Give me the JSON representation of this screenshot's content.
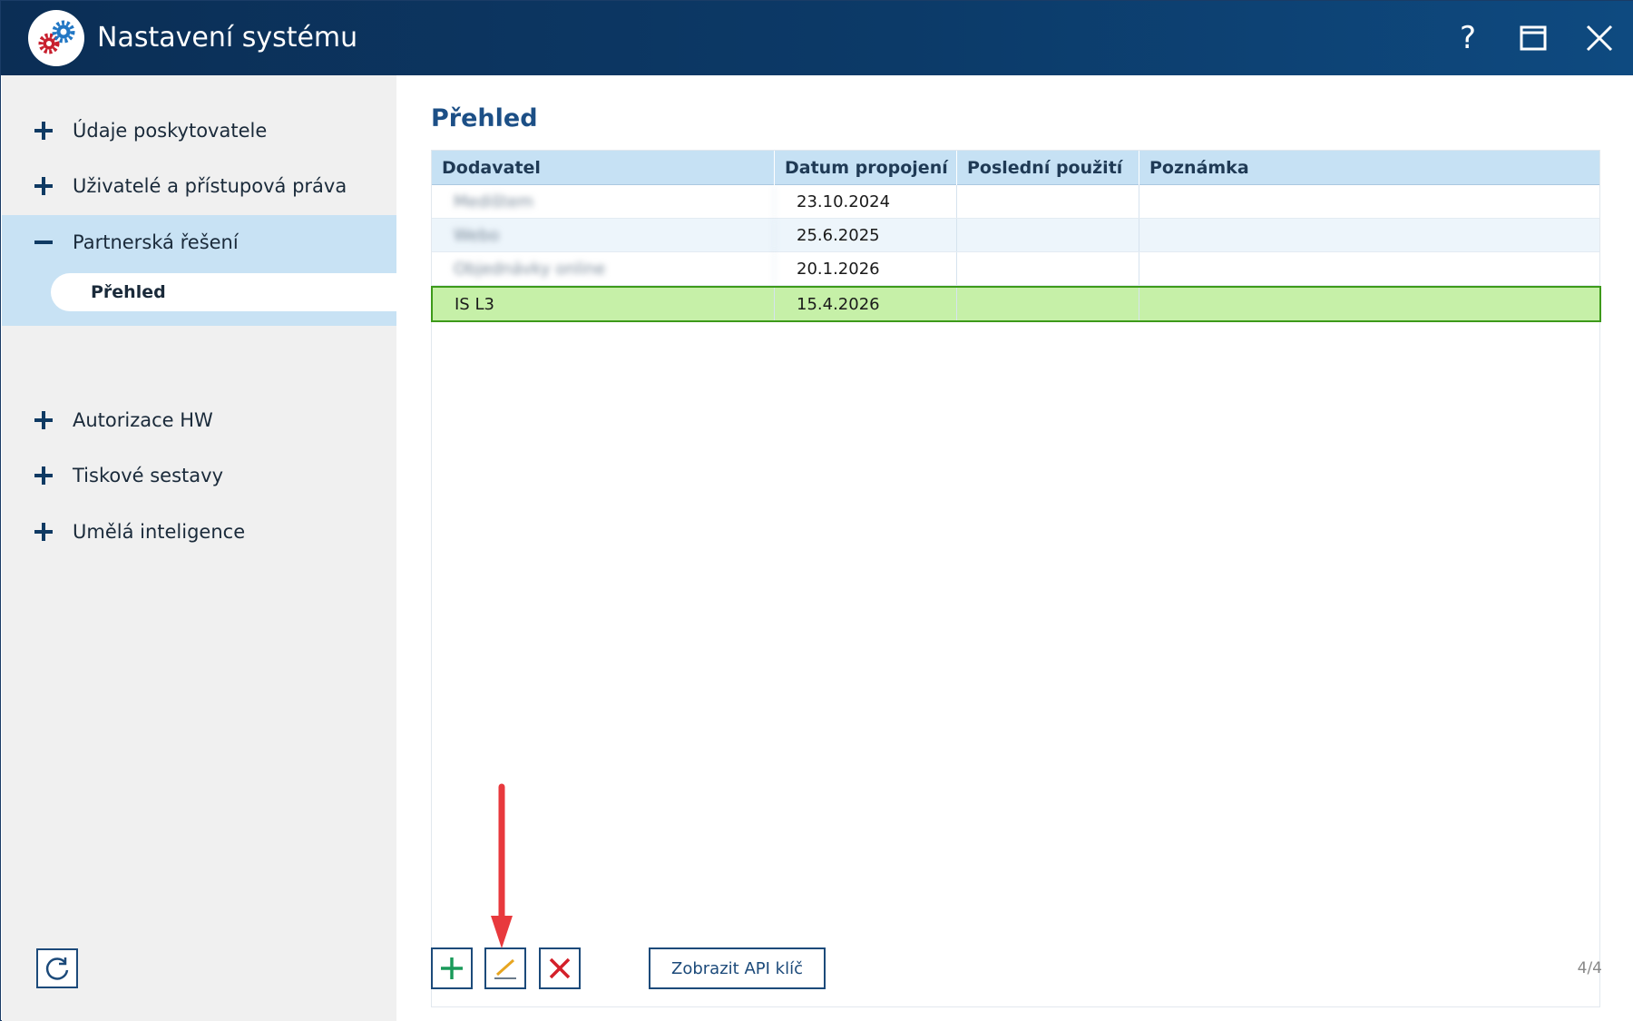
{
  "window": {
    "title": "Nastavení systému",
    "help_label": "?",
    "accent": "#0c3a68"
  },
  "sidebar": {
    "items": [
      {
        "label": "Údaje poskytovatele",
        "state": "collapsed"
      },
      {
        "label": "Uživatelé a přístupová práva",
        "state": "collapsed"
      },
      {
        "label": "Partnerská řešení",
        "state": "expanded"
      },
      {
        "label": "Autorizace HW",
        "state": "collapsed"
      },
      {
        "label": "Tiskové sestavy",
        "state": "collapsed"
      },
      {
        "label": "Umělá inteligence",
        "state": "collapsed"
      }
    ],
    "subitem": {
      "label": "Přehled",
      "selected": true
    }
  },
  "main": {
    "title": "Přehled",
    "columns": [
      "Dodavatel",
      "Datum propojení",
      "Poslední použití",
      "Poznámka"
    ],
    "rows": [
      {
        "dodavatel": "Medištem",
        "datum": "23.10.2024",
        "posledni": "",
        "poznamka": "",
        "blurred": true
      },
      {
        "dodavatel": "Webo",
        "datum": "25.6.2025",
        "posledni": "",
        "poznamka": "",
        "blurred": true
      },
      {
        "dodavatel": "Objednávky online",
        "datum": "20.1.2026",
        "posledni": "",
        "poznamka": "",
        "blurred": true
      },
      {
        "dodavatel": "IS L3",
        "datum": "15.4.2026",
        "posledni": "",
        "poznamka": "",
        "blurred": false,
        "selected": true
      }
    ],
    "toolbar": {
      "add_icon": "plus-icon",
      "edit_icon": "pencil-icon",
      "delete_icon": "delete-x-icon",
      "api_button": "Zobrazit API klíč"
    },
    "counter": "4/4"
  },
  "colors": {
    "selected_row": "#c6f0a8",
    "selected_border": "#3d9a1a",
    "header_bg": "#c6e1f4",
    "annotation_arrow": "#e8393d"
  }
}
